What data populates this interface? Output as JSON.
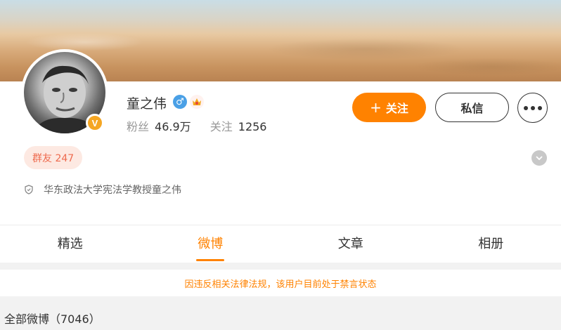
{
  "profile": {
    "username": "童之伟",
    "verified_badge": "V",
    "stats": {
      "followers_label": "粉丝",
      "followers_value": "46.9万",
      "following_label": "关注",
      "following_value": "1256"
    },
    "group_badge": "群友 247",
    "description": "华东政法大学宪法学教授童之伟",
    "gender": "male",
    "icons": [
      "male-gender-icon",
      "vip-crown-icon",
      "verified-badge-icon",
      "shield-icon",
      "chevron-down-icon",
      "more-icon",
      "plus-icon"
    ]
  },
  "actions": {
    "follow_plus": "+",
    "follow_label": "关注",
    "message_label": "私信"
  },
  "tabs": [
    {
      "label": "精选",
      "active": false
    },
    {
      "label": "微博",
      "active": true
    },
    {
      "label": "文章",
      "active": false
    },
    {
      "label": "相册",
      "active": false
    }
  ],
  "notice": "因违反相关法律法规，该用户目前处于禁言状态",
  "posts_header": "全部微博（7046）",
  "colors": {
    "accent": "#ff8200",
    "verified": "#f5a623",
    "gender": "#4aa0e6",
    "badge_text": "#ee6b4f"
  }
}
